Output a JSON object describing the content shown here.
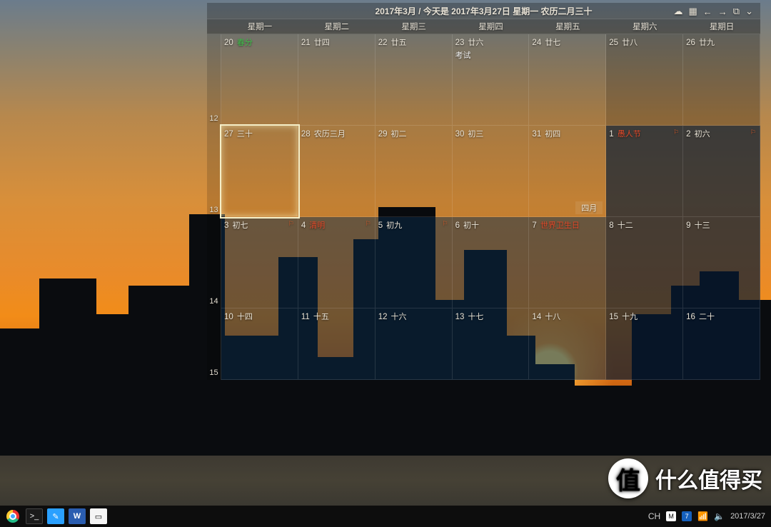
{
  "header": {
    "title": "2017年3月 / 今天是 2017年3月27日 星期一 农历二月三十"
  },
  "icons": {
    "cloud": "☁",
    "calendar": "▦",
    "prev": "←",
    "next": "→",
    "screens": "⧉",
    "chevron": "⌄"
  },
  "dow": [
    "星期一",
    "星期二",
    "星期三",
    "星期四",
    "星期五",
    "星期六",
    "星期日"
  ],
  "weeks": [
    {
      "num": "12",
      "days": [
        {
          "d": "20",
          "l": "春分",
          "green": true
        },
        {
          "d": "21",
          "l": "廿四"
        },
        {
          "d": "22",
          "l": "廿五"
        },
        {
          "d": "23",
          "l": "廿六",
          "event": "考试"
        },
        {
          "d": "24",
          "l": "廿七"
        },
        {
          "d": "25",
          "l": "廿八",
          "weekend": true
        },
        {
          "d": "26",
          "l": "廿九",
          "weekend": true
        }
      ]
    },
    {
      "num": "13",
      "days": [
        {
          "d": "27",
          "l": "三十",
          "today": true
        },
        {
          "d": "28",
          "l": "农历三月"
        },
        {
          "d": "29",
          "l": "初二"
        },
        {
          "d": "30",
          "l": "初三"
        },
        {
          "d": "31",
          "l": "初四",
          "monthLabel": "四月"
        },
        {
          "d": "1",
          "l": "愚人节",
          "special": true,
          "weekend": true,
          "next": true,
          "flag": true
        },
        {
          "d": "2",
          "l": "初六",
          "weekend": true,
          "next": true,
          "flag": true
        }
      ]
    },
    {
      "num": "14",
      "days": [
        {
          "d": "3",
          "l": "初七",
          "next": true,
          "flag": true
        },
        {
          "d": "4",
          "l": "清明",
          "special": true,
          "next": true,
          "flag": true
        },
        {
          "d": "5",
          "l": "初九",
          "next": true,
          "flag": true
        },
        {
          "d": "6",
          "l": "初十",
          "next": true
        },
        {
          "d": "7",
          "l": "世界卫生日",
          "special": true,
          "next": true
        },
        {
          "d": "8",
          "l": "十二",
          "weekend": true,
          "next": true
        },
        {
          "d": "9",
          "l": "十三",
          "weekend": true,
          "next": true
        }
      ]
    },
    {
      "num": "15",
      "short": true,
      "days": [
        {
          "d": "10",
          "l": "十四",
          "next": true
        },
        {
          "d": "11",
          "l": "十五",
          "next": true
        },
        {
          "d": "12",
          "l": "十六",
          "next": true
        },
        {
          "d": "13",
          "l": "十七",
          "next": true
        },
        {
          "d": "14",
          "l": "十八",
          "next": true
        },
        {
          "d": "15",
          "l": "十九",
          "weekend": true,
          "next": true
        },
        {
          "d": "16",
          "l": "二十",
          "weekend": true,
          "next": true
        }
      ]
    }
  ],
  "taskbar": {
    "apps": [
      "chrome",
      "terminal",
      "notes",
      "word",
      "notepad"
    ],
    "tray": {
      "ch": "CH",
      "m": "M",
      "seven": "7"
    },
    "clock": "2017/3/27"
  },
  "watermark": {
    "badge": "值",
    "text": "什么值得买"
  }
}
